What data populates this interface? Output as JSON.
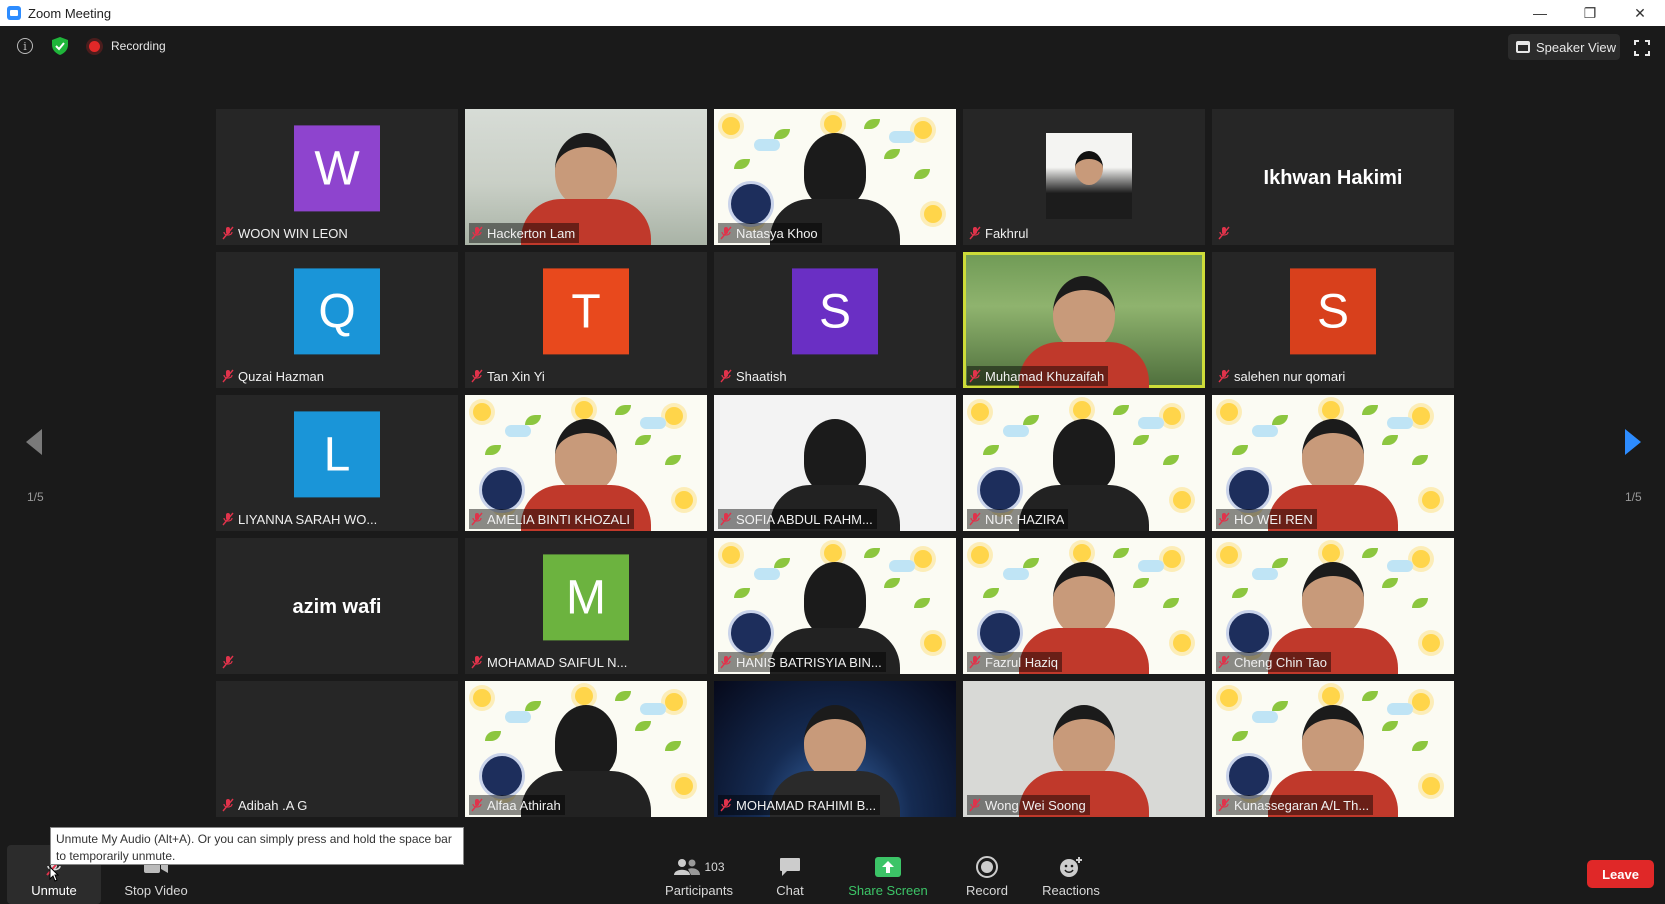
{
  "window": {
    "title": "Zoom Meeting",
    "controls": {
      "minimize": "—",
      "restore": "❐",
      "close": "✕"
    }
  },
  "topbar": {
    "info_glyph": "i",
    "recording_label": "Recording",
    "speaker_view_label": "Speaker View"
  },
  "page_nav": {
    "left_count": "1/5",
    "right_count": "1/5"
  },
  "participants": [
    {
      "name": "WOON WIN LEON",
      "type": "avatar",
      "initial": "W",
      "color": "#8e44ce"
    },
    {
      "name": "Hackerton Lam",
      "type": "video",
      "scene": "room"
    },
    {
      "name": "Natasya Khoo",
      "type": "video",
      "scene": "frame"
    },
    {
      "name": "Fakhrul",
      "type": "photo"
    },
    {
      "name": "Ikhwan Hakimi",
      "type": "name"
    },
    {
      "name": "Quzai Hazman",
      "type": "avatar",
      "initial": "Q",
      "color": "#1a95d8"
    },
    {
      "name": "Tan Xin Yi",
      "type": "avatar",
      "initial": "T",
      "color": "#e8491d"
    },
    {
      "name": "Shaatish",
      "type": "avatar",
      "initial": "S",
      "color": "#6a2fc4"
    },
    {
      "name": "Muhamad Khuzaifah",
      "type": "video",
      "scene": "trees",
      "active": true
    },
    {
      "name": "salehen nur qomari",
      "type": "avatar",
      "initial": "S",
      "color": "#d8401c"
    },
    {
      "name": "LIYANNA SARAH WO...",
      "type": "avatar",
      "initial": "L",
      "color": "#1a95d8"
    },
    {
      "name": "AMELIA BINTI KHOZALI",
      "type": "video",
      "scene": "frame"
    },
    {
      "name": "SOFIA ABDUL RAHM...",
      "type": "video",
      "scene": "white"
    },
    {
      "name": "NUR HAZIRA",
      "type": "video",
      "scene": "frame"
    },
    {
      "name": "HO WEI REN",
      "type": "video",
      "scene": "frame"
    },
    {
      "name": "azim wafi",
      "type": "name"
    },
    {
      "name": "MOHAMAD SAIFUL N...",
      "type": "avatar",
      "initial": "M",
      "color": "#6cb33f"
    },
    {
      "name": "HANIS BATRISYIA BIN...",
      "type": "video",
      "scene": "frame"
    },
    {
      "name": "Fazrul Haziq",
      "type": "video",
      "scene": "frame"
    },
    {
      "name": "Cheng Chin Tao",
      "type": "video",
      "scene": "frame"
    },
    {
      "name": "Adibah .A G",
      "type": "blank"
    },
    {
      "name": "Alfaa Athirah",
      "type": "video",
      "scene": "frame"
    },
    {
      "name": "MOHAMAD RAHIMI B...",
      "type": "video",
      "scene": "space"
    },
    {
      "name": "Wong Wei Soong",
      "type": "video",
      "scene": "wall"
    },
    {
      "name": "Kunassegaran A/L Th...",
      "type": "video",
      "scene": "frame"
    }
  ],
  "toolbar": {
    "unmute_label": "Unmute",
    "stop_video_label": "Stop Video",
    "participants_label": "Participants",
    "participants_count": "103",
    "chat_label": "Chat",
    "share_screen_label": "Share Screen",
    "record_label": "Record",
    "reactions_label": "Reactions",
    "leave_label": "Leave"
  },
  "tooltip": {
    "text": "Unmute My Audio (Alt+A). Or you can simply press and hold the space bar to temporarily unmute."
  },
  "colors": {
    "accent_blue": "#2d8cff",
    "share_green": "#3cc467",
    "leave_red": "#e02828",
    "active_speaker": "#cddc39",
    "mute_red": "#e0334b"
  }
}
